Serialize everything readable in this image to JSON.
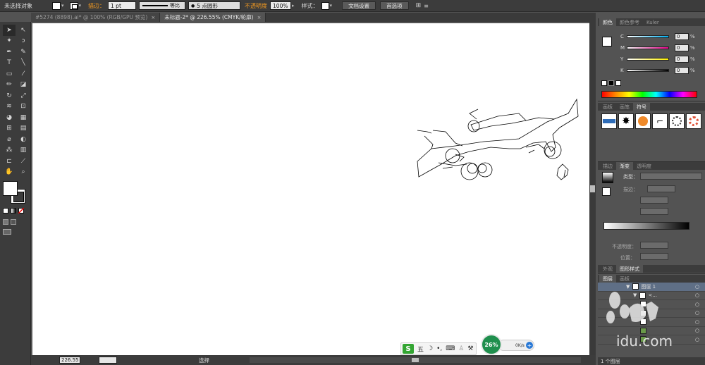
{
  "control_bar": {
    "selection_label": "未选择对象",
    "stroke_label": "描边：",
    "stroke_weight": "1 pt",
    "stroke_profile": "等比",
    "brush": "5 点圆形",
    "opacity_label": "不透明度",
    "opacity_value": "100%",
    "style_label": "样式：",
    "doc_setup_button": "文档设置",
    "prefs_button": "首选项"
  },
  "tabs": [
    {
      "label": "#5274 (8898).ai* @ 100% (RGB/GPU 预览)",
      "close": "×"
    },
    {
      "label": "未标题-2* @ 226.55% (CMYK/轮廓)",
      "close": "×"
    }
  ],
  "status_bar": {
    "zoom": "226.55",
    "status": "选择"
  },
  "color_panel": {
    "tabs": [
      "颜色",
      "颜色参考",
      "Kuler"
    ],
    "sliders": [
      {
        "letter": "C",
        "value": "0",
        "color": "#00aeef"
      },
      {
        "letter": "M",
        "value": "0",
        "color": "#ec008c"
      },
      {
        "letter": "Y",
        "value": "0",
        "color": "#fff200"
      },
      {
        "letter": "K",
        "value": "0",
        "color": "#000000"
      }
    ],
    "percent": "%"
  },
  "symbols_panel": {
    "tabs": [
      "画板",
      "画笔",
      "符号"
    ]
  },
  "gradient_panel": {
    "tabs": [
      "描边",
      "渐变",
      "透明度"
    ],
    "type_label": "类型：",
    "stroke_label": "描边：",
    "opacity_label": "不透明度：",
    "position_label": "位置："
  },
  "appearance_panel": {
    "tabs": [
      "外观",
      "图形样式"
    ]
  },
  "layers_panel": {
    "tabs": [
      "图层",
      "画板"
    ],
    "layers": [
      {
        "name": "图层 1"
      },
      {
        "name": "<..."
      },
      {
        "name": ""
      },
      {
        "name": ""
      },
      {
        "name": ""
      },
      {
        "name": ""
      },
      {
        "name": ""
      }
    ],
    "footer": "1 个图层"
  },
  "ime": {
    "logo": "S",
    "mode": "五"
  },
  "net_widget": {
    "percent": "26%",
    "speed": "0K/s",
    "plus": "+"
  },
  "watermark": {
    "text": "idu.com"
  }
}
